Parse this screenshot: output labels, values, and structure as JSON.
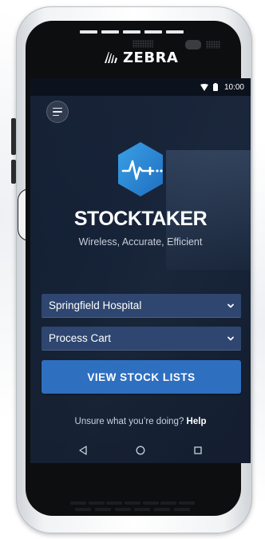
{
  "device": {
    "brand": "ZEBRA"
  },
  "status_bar": {
    "time": "10:00",
    "icons": [
      "wifi-icon",
      "battery-icon"
    ]
  },
  "app": {
    "menu_icon": "menu-icon",
    "logo_icon": "pulse-hexagon-logo",
    "title": "STOCKTAKER",
    "subtitle": "Wireless, Accurate, Efficient",
    "location_select": {
      "value": "Springfield Hospital",
      "icon": "chevron-down-icon"
    },
    "cart_select": {
      "value": "Process Cart",
      "icon": "chevron-down-icon"
    },
    "primary_button": "VIEW STOCK LISTS",
    "help_prompt": "Unsure what you’re doing?",
    "help_link": "Help"
  },
  "nav_bar": {
    "icons": [
      "back-icon",
      "home-icon",
      "recents-icon"
    ]
  },
  "colors": {
    "button_blue": "#2e6fc0",
    "select_blue": "#2e4670",
    "logo_blue": "#2f8fd8"
  }
}
